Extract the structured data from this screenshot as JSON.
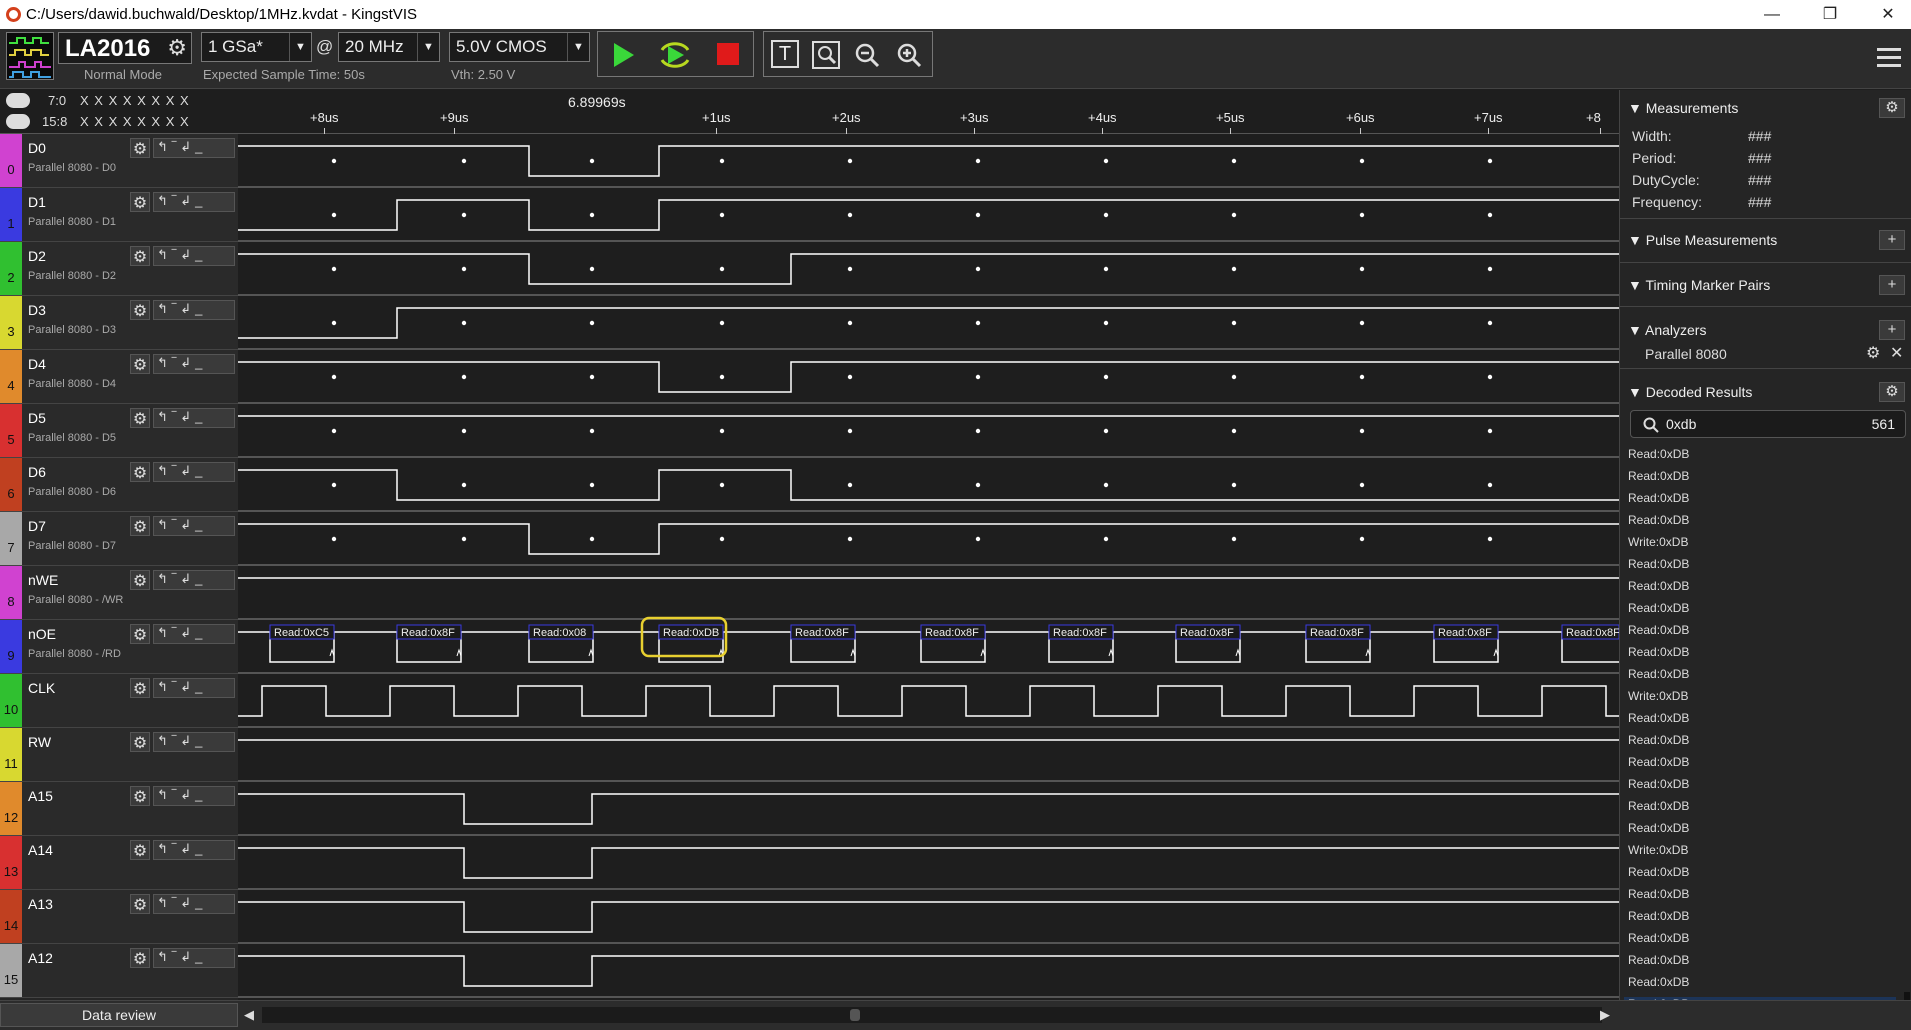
{
  "window": {
    "title": "C:/Users/dawid.buchwald/Desktop/1MHz.kvdat - KingstVIS"
  },
  "toolbar": {
    "device": "LA2016",
    "mode": "Normal Mode",
    "sample_rate": "1 GSa*",
    "at": "@",
    "frequency": "20 MHz",
    "voltage": "5.0V CMOS",
    "expected_time": "Expected Sample Time: 50s",
    "vth": "Vth: 2.50 V"
  },
  "channel_groups": {
    "g1_label": "7:0",
    "g1_values": "X X X X X X X X",
    "g2_label": "15:8",
    "g2_values": "X X X X X X X X"
  },
  "ruler": {
    "cursor": "6.89969s",
    "ticks": [
      "+8us",
      "+9us",
      "+1us",
      "+2us",
      "+3us",
      "+4us",
      "+5us",
      "+6us",
      "+7us",
      "+8"
    ]
  },
  "channels": [
    {
      "num": "0",
      "name": "D0",
      "sub": "Parallel 8080 - D0",
      "color": "#d042d0"
    },
    {
      "num": "1",
      "name": "D1",
      "sub": "Parallel 8080 - D1",
      "color": "#3a3ae0"
    },
    {
      "num": "2",
      "name": "D2",
      "sub": "Parallel 8080 - D2",
      "color": "#30c030"
    },
    {
      "num": "3",
      "name": "D3",
      "sub": "Parallel 8080 - D3",
      "color": "#d8d830"
    },
    {
      "num": "4",
      "name": "D4",
      "sub": "Parallel 8080 - D4",
      "color": "#e08a2c"
    },
    {
      "num": "5",
      "name": "D5",
      "sub": "Parallel 8080 - D5",
      "color": "#d83030"
    },
    {
      "num": "6",
      "name": "D6",
      "sub": "Parallel 8080 - D6",
      "color": "#c04020"
    },
    {
      "num": "7",
      "name": "D7",
      "sub": "Parallel 8080 - D7",
      "color": "#a8a8a8"
    },
    {
      "num": "8",
      "name": "nWE",
      "sub": "Parallel 8080 - /WR",
      "color": "#d042d0"
    },
    {
      "num": "9",
      "name": "nOE",
      "sub": "Parallel 8080 - /RD",
      "color": "#3a3ae0"
    },
    {
      "num": "10",
      "name": "CLK",
      "sub": "",
      "color": "#30c030"
    },
    {
      "num": "11",
      "name": "RW",
      "sub": "",
      "color": "#d8d830"
    },
    {
      "num": "12",
      "name": "A15",
      "sub": "",
      "color": "#e08a2c"
    },
    {
      "num": "13",
      "name": "A14",
      "sub": "",
      "color": "#d83030"
    },
    {
      "num": "14",
      "name": "A13",
      "sub": "",
      "color": "#c04020"
    },
    {
      "num": "15",
      "name": "A12",
      "sub": "",
      "color": "#a8a8a8"
    }
  ],
  "decode_labels": [
    "Read:0xC5",
    "Read:0x8F",
    "Read:0x08",
    "Read:0xDB",
    "Read:0x8F",
    "Read:0x8F",
    "Read:0x8F",
    "Read:0x8F",
    "Read:0x8F",
    "Read:0x8F",
    "Read:0x8F"
  ],
  "panel": {
    "measurements": "Measurements",
    "width_label": "Width:",
    "period_label": "Period:",
    "duty_label": "DutyCycle:",
    "freq_label": "Frequency:",
    "placeholder": "###",
    "pulse": "Pulse Measurements",
    "timing": "Timing Marker Pairs",
    "analyzers": "Analyzers",
    "analyzer_name": "Parallel 8080",
    "decoded": "Decoded Results",
    "search_value": "0xdb",
    "search_count": "561",
    "results": [
      "Read:0xDB",
      "Read:0xDB",
      "Read:0xDB",
      "Read:0xDB",
      "Write:0xDB",
      "Read:0xDB",
      "Read:0xDB",
      "Read:0xDB",
      "Read:0xDB",
      "Read:0xDB",
      "Read:0xDB",
      "Write:0xDB",
      "Read:0xDB",
      "Read:0xDB",
      "Read:0xDB",
      "Read:0xDB",
      "Read:0xDB",
      "Read:0xDB",
      "Write:0xDB",
      "Read:0xDB",
      "Read:0xDB",
      "Read:0xDB",
      "Read:0xDB",
      "Read:0xDB",
      "Read:0xDB",
      "Read:0xDB"
    ]
  },
  "bottom": {
    "data_review": "Data review"
  }
}
